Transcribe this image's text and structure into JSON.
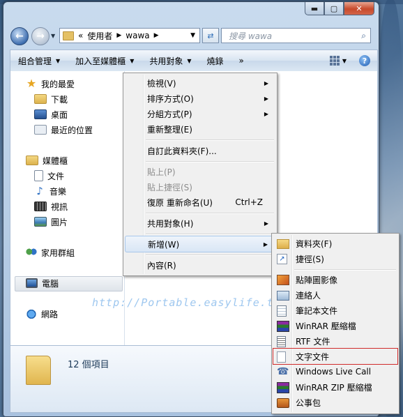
{
  "window": {
    "caption_buttons": {
      "minimize": "▬",
      "maximize": "▢",
      "close": "✕"
    }
  },
  "address": {
    "prefix": "«",
    "path": [
      "使用者",
      "wawa"
    ],
    "search_placeholder": "搜尋 wawa"
  },
  "toolbar": {
    "items": [
      "組合管理",
      "加入至媒體櫃",
      "共用對象",
      "燒錄"
    ],
    "more": "»",
    "help": "?"
  },
  "nav": {
    "favorites": {
      "label": "我的最愛",
      "items": [
        "下載",
        "桌面",
        "最近的位置"
      ]
    },
    "libraries": {
      "label": "媒體櫃",
      "items": [
        "文件",
        "音樂",
        "視訊",
        "圖片"
      ]
    },
    "homegroup": "家用群組",
    "computer": "電腦",
    "network": "網路"
  },
  "status": {
    "count": "12 個項目"
  },
  "watermark": "http://Portable.easylife.tw",
  "context_menu": {
    "items": [
      {
        "label": "檢視(V)",
        "submenu": true
      },
      {
        "label": "排序方式(O)",
        "submenu": true
      },
      {
        "label": "分組方式(P)",
        "submenu": true
      },
      {
        "label": "重新整理(E)"
      },
      {
        "label": "自訂此資料夾(F)..."
      },
      {
        "label": "貼上(P)",
        "disabled": true
      },
      {
        "label": "貼上捷徑(S)",
        "disabled": true
      },
      {
        "label": "復原 重新命名(U)",
        "accel": "Ctrl+Z"
      },
      {
        "label": "共用對象(H)",
        "submenu": true
      },
      {
        "label": "新增(W)",
        "submenu": true,
        "highlighted": true
      },
      {
        "label": "內容(R)"
      }
    ]
  },
  "new_submenu": {
    "items": [
      {
        "label": "資料夾(F)",
        "icon": "folder-icon"
      },
      {
        "label": "捷徑(S)",
        "icon": "shortcut-icon"
      },
      {
        "label": "點陣圖影像",
        "icon": "bitmap-icon"
      },
      {
        "label": "連絡人",
        "icon": "contact-icon"
      },
      {
        "label": "筆記本文件",
        "icon": "notepad-icon"
      },
      {
        "label": "WinRAR 壓縮檔",
        "icon": "winrar-icon"
      },
      {
        "label": "RTF 文件",
        "icon": "rtf-icon"
      },
      {
        "label": "文字文件",
        "icon": "text-document-icon",
        "highlighted": true
      },
      {
        "label": "Windows Live Call",
        "icon": "live-call-icon"
      },
      {
        "label": "WinRAR ZIP 壓縮檔",
        "icon": "winrar-zip-icon"
      },
      {
        "label": "公事包",
        "icon": "briefcase-icon"
      }
    ]
  }
}
